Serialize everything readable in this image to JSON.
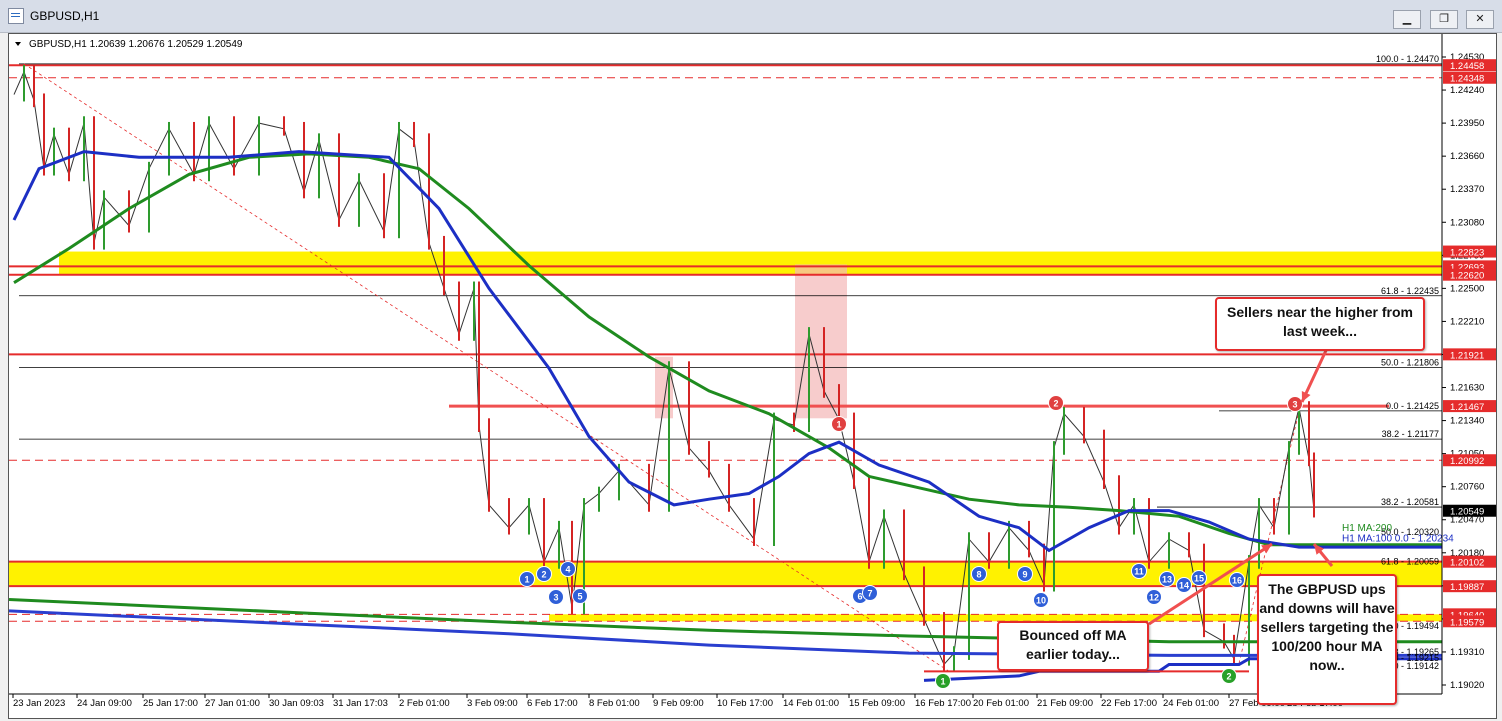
{
  "window": {
    "title": "GBPUSD,H1",
    "minimize": "▁",
    "restore": "❐",
    "close": "✕"
  },
  "header": {
    "symbol_line": "GBPUSD,H1  1.20639 1.20676 1.20529 1.20549"
  },
  "colors": {
    "bull": "#2e9b2e",
    "bear": "#d42424",
    "ma100": "#1c2fc4",
    "ma200": "#1f8b1f",
    "zone": "#fff200",
    "res_line": "#e52b2b",
    "badge_blue": "#2f5fd8",
    "badge_red": "#e04040",
    "badge_green": "#28a028",
    "fib": "#000000"
  },
  "price_scale": {
    "ticks": [
      "1.24530",
      "1.24240",
      "1.23950",
      "1.23660",
      "1.23370",
      "1.23080",
      "1.22790",
      "1.22500",
      "1.22210",
      "1.21920",
      "1.21630",
      "1.21340",
      "1.21050",
      "1.20760",
      "1.20470",
      "1.20180",
      "1.19890",
      "1.19600",
      "1.19310",
      "1.19020"
    ],
    "labels": [
      {
        "text": "1.24458",
        "bg": "#e52b2b",
        "price": 1.24458
      },
      {
        "text": "1.24348",
        "bg": "#e52b2b",
        "price": 1.24348
      },
      {
        "text": "1.22823",
        "bg": "#e52b2b",
        "price": 1.22823
      },
      {
        "text": "1.22693",
        "bg": "#e52b2b",
        "price": 1.22693
      },
      {
        "text": "1.22620",
        "bg": "#e52b2b",
        "price": 1.2262
      },
      {
        "text": "1.21921",
        "bg": "#e52b2b",
        "price": 1.21921
      },
      {
        "text": "1.21467",
        "bg": "#e52b2b",
        "price": 1.21467
      },
      {
        "text": "1.20992",
        "bg": "#e52b2b",
        "price": 1.20992
      },
      {
        "text": "1.20549",
        "bg": "#000000",
        "price": 1.20549
      },
      {
        "text": "1.20102",
        "bg": "#e52b2b",
        "price": 1.20102
      },
      {
        "text": "1.19887",
        "bg": "#e52b2b",
        "price": 1.19887
      },
      {
        "text": "1.19640",
        "bg": "#e52b2b",
        "price": 1.1964
      },
      {
        "text": "1.19579",
        "bg": "#e52b2b",
        "price": 1.19579
      }
    ]
  },
  "time_axis": [
    "23 Jan 2023",
    "24 Jan 09:00",
    "25 Jan 17:00",
    "27 Jan 01:00",
    "30 Jan 09:03",
    "31 Jan 17:03",
    "2 Feb 01:00",
    "3 Feb 09:00",
    "6 Feb 17:00",
    "8 Feb 01:00",
    "9 Feb 09:00",
    "10 Feb 17:00",
    "14 Feb 01:00",
    "15 Feb 09:00",
    "16 Feb 17:00",
    "20 Feb 01:00",
    "21 Feb 09:00",
    "22 Feb 17:00",
    "24 Feb 01:00",
    "27 Feb 09:00",
    "28 Feb 17:00"
  ],
  "fib_labels": [
    {
      "text": "100.0 - 1.24470",
      "price": 1.2447
    },
    {
      "text": "61.8 - 1.22435",
      "price": 1.22435
    },
    {
      "text": "50.0 - 1.21806",
      "price": 1.21806
    },
    {
      "text": "0.0 - 1.21425",
      "price": 1.21425
    },
    {
      "text": "38.2 - 1.21177",
      "price": 1.21177
    },
    {
      "text": "38.2 - 1.20581",
      "price": 1.20581
    },
    {
      "text": "50.0 - 1.20320",
      "price": 1.2032
    },
    {
      "text": "61.8 - 1.20059",
      "price": 1.20059
    },
    {
      "text": "50.0 - 1.19494",
      "price": 1.19494
    },
    {
      "text": "61.8 - 1.19265",
      "price": 1.19265
    },
    {
      "text": "0.0 - 1.19215",
      "price": 1.19215
    },
    {
      "text": "0.0 - 1.19142",
      "price": 1.19142
    }
  ],
  "ma_labels": {
    "ma200": "H1 MA:200",
    "ma100": "H1 MA:100 0.0 - 1.20234"
  },
  "badges": [
    {
      "n": "1",
      "color": "blue"
    },
    {
      "n": "2",
      "color": "blue"
    },
    {
      "n": "3",
      "color": "blue"
    },
    {
      "n": "4",
      "color": "blue"
    },
    {
      "n": "5",
      "color": "blue"
    },
    {
      "n": "6",
      "color": "blue"
    },
    {
      "n": "7",
      "color": "blue"
    },
    {
      "n": "8",
      "color": "blue"
    },
    {
      "n": "9",
      "color": "blue"
    },
    {
      "n": "10",
      "color": "blue"
    },
    {
      "n": "11",
      "color": "blue"
    },
    {
      "n": "12",
      "color": "blue"
    },
    {
      "n": "13",
      "color": "blue"
    },
    {
      "n": "14",
      "color": "blue"
    },
    {
      "n": "15",
      "color": "blue"
    },
    {
      "n": "16",
      "color": "blue"
    },
    {
      "n": "1",
      "color": "red"
    },
    {
      "n": "2",
      "color": "red"
    },
    {
      "n": "3",
      "color": "red"
    },
    {
      "n": "1",
      "color": "green"
    },
    {
      "n": "2",
      "color": "green"
    }
  ],
  "annotations": {
    "sellers": "Sellers near the higher from last week...",
    "bounced": "Bounced off MA earlier today...",
    "targeting": "The GBPUSD ups and downs will have sellers targeting the 100/200 hour MA now.."
  }
}
